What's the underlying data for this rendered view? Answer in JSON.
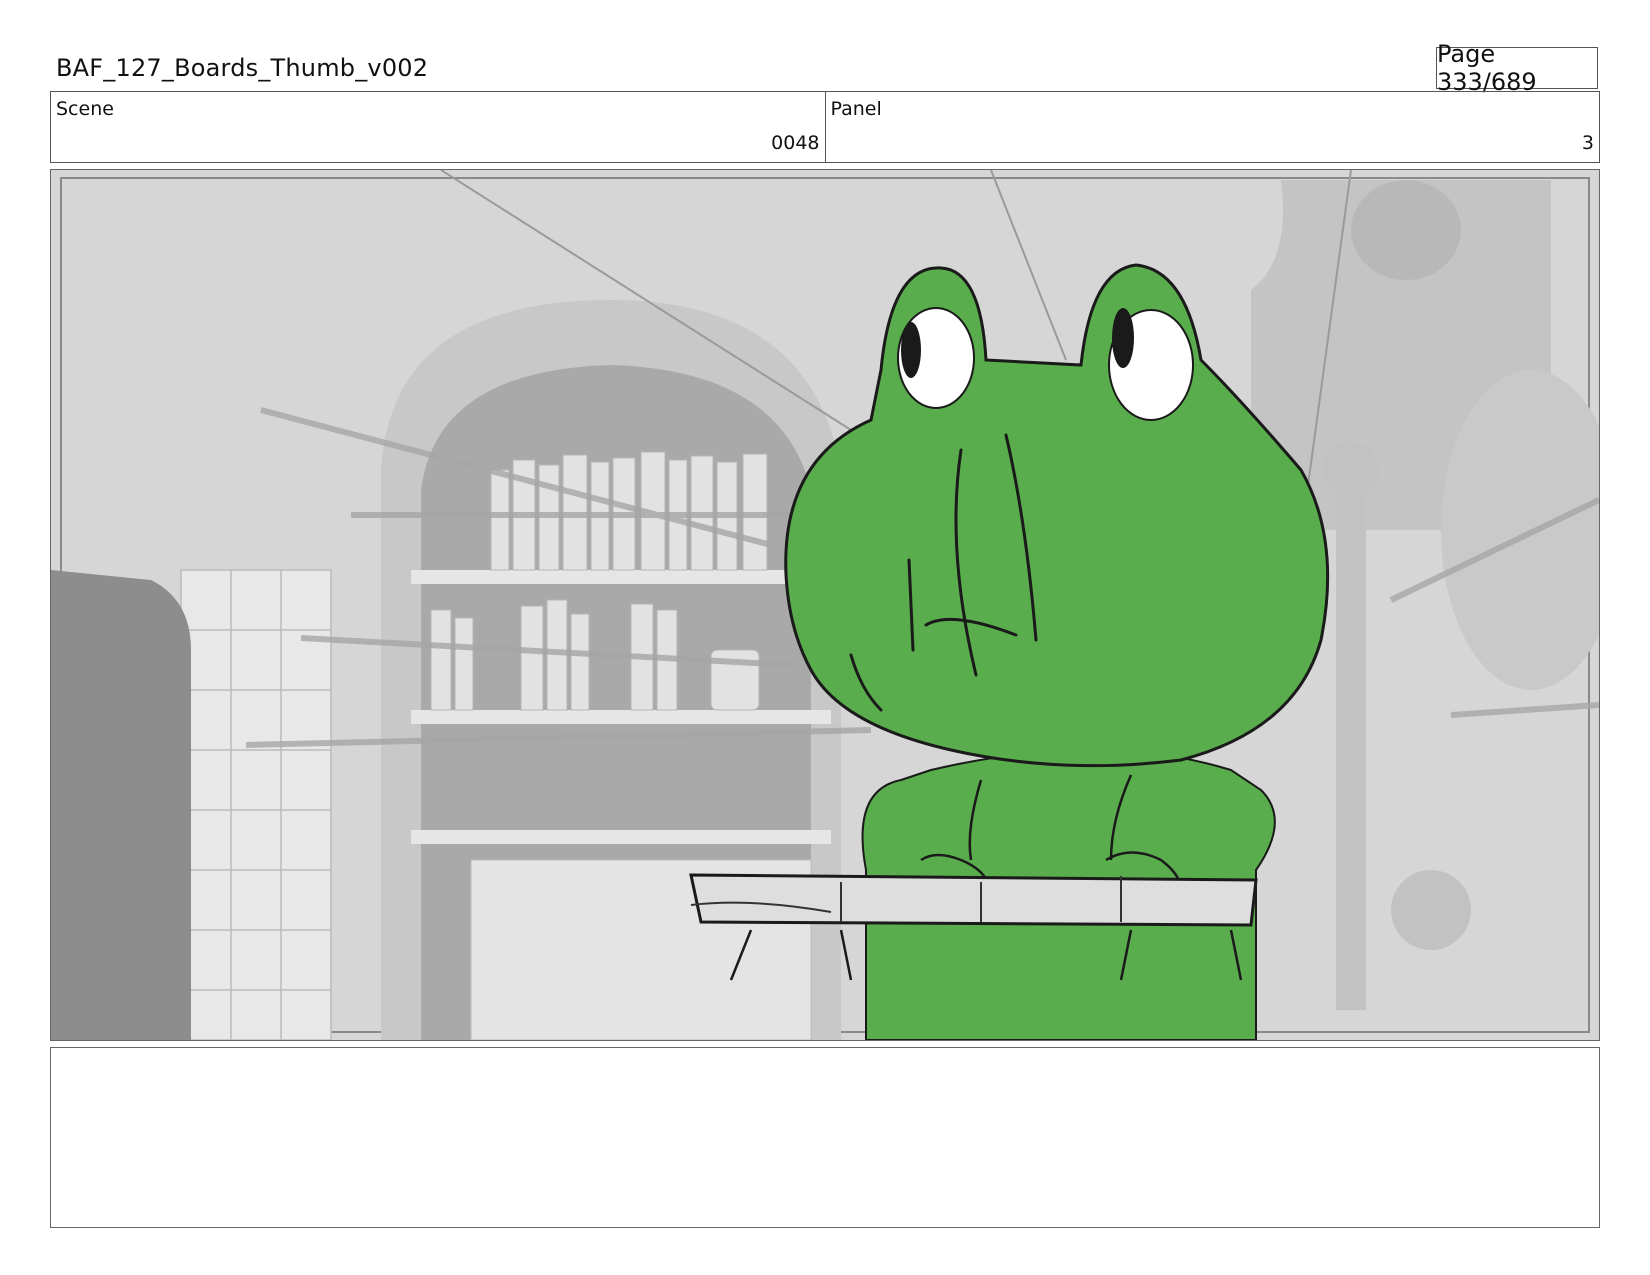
{
  "header": {
    "title": "BAF_127_Boards_Thumb_v002",
    "page": "Page 333/689"
  },
  "scene": {
    "label": "Scene",
    "value": "0048"
  },
  "panel": {
    "label": "Panel",
    "value": "3"
  },
  "colors": {
    "frog_green": "#5aad4c",
    "background_gray": "#d9d9d9",
    "line_black": "#1a1a1a"
  },
  "icons": {
    "panel_image": "frog-character-sketch"
  },
  "notes": {
    "text": ""
  }
}
